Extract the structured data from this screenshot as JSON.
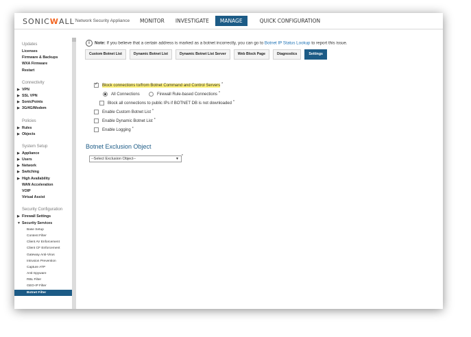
{
  "header": {
    "logo_text": "SONICWALL",
    "product": "Network Security Appliance",
    "nav": [
      "MONITOR",
      "INVESTIGATE",
      "MANAGE",
      "QUICK CONFIGURATION"
    ],
    "active_nav": "MANAGE",
    "accent_color": "#1c5b86",
    "logo_color": "#f26522"
  },
  "sidebar": {
    "updates": {
      "title": "Updates",
      "items": [
        "Licenses",
        "Firmware & Backups",
        "WXA Firmware",
        "Restart"
      ]
    },
    "connectivity": {
      "title": "Connectivity",
      "items": [
        "VPN",
        "SSL VPN",
        "SonicPoints",
        "3G/4G/Modem"
      ]
    },
    "policies": {
      "title": "Policies",
      "items": [
        "Rules",
        "Objects"
      ]
    },
    "system_setup": {
      "title": "System Setup",
      "items": [
        "Appliance",
        "Users",
        "Network",
        "Switching",
        "High Availability",
        "WAN Acceleration",
        "VOIP",
        "Virtual Assist"
      ]
    },
    "security_configuration": {
      "title": "Security Configuration",
      "items": [
        "Firewall Settings",
        "Security Services"
      ],
      "sub_items": [
        "Base Setup",
        "Content Filter",
        "Client AV Enforcement",
        "Client CF Enforcement",
        "Gateway Anti-Virus",
        "Intrusion Prevention",
        "Capture ATP",
        "Anti-Spyware",
        "RBL Filter",
        "GEO-IP Filter",
        "Botnet Filter"
      ],
      "active_sub": "Botnet Filter"
    }
  },
  "main": {
    "note_label": "Note:",
    "note_text": " If you believe that a certain address is marked as a botnet incorrectly, you can go to ",
    "note_link": "Botnet IP Status Lookup",
    "note_suffix": " to report this issue.",
    "tabs": [
      "Custom Botnet List",
      "Dynamic Botnet List",
      "Dynamic Botnet List Server",
      "Web Block Page",
      "Diagnostics",
      "Settings"
    ],
    "active_tab": "Settings",
    "options": {
      "block_connections": "Block connections to/from Botnet Command and Control Servers",
      "all_connections": "All Connections",
      "firewall_rule_based": "Firewall Rule-based Connections",
      "block_public_ips": "Block all connections to public IPs if BOTNET DB is not downloaded",
      "enable_custom": "Enable Custom Botnet List",
      "enable_dynamic": "Enable Dynamic Botnet List",
      "enable_logging": "Enable Logging"
    },
    "star": "*",
    "exclusion_title": "Botnet Exclusion Object",
    "exclusion_select": "--Select Exclusion Object--"
  }
}
